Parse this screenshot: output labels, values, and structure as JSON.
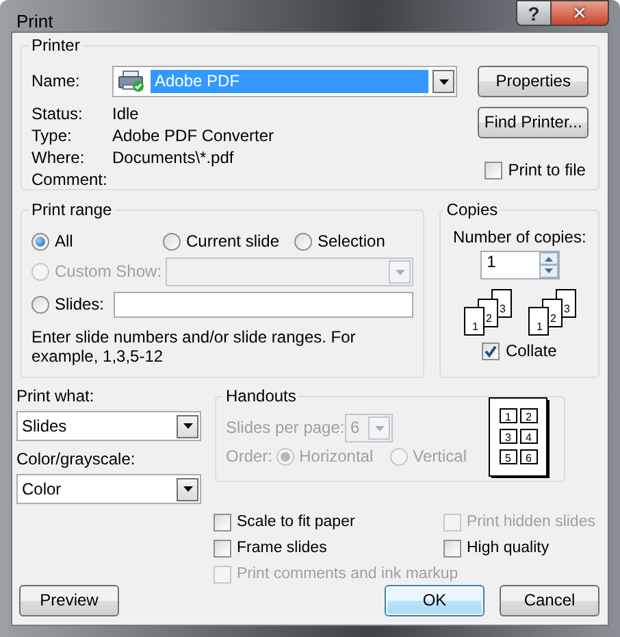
{
  "window": {
    "title": "Print",
    "help_button": "?",
    "close_button": "✕"
  },
  "printer": {
    "legend": "Printer",
    "name_label": "Name:",
    "name_value": "Adobe PDF",
    "name_highlighted": true,
    "info": [
      {
        "label": "Status:",
        "value": "Idle"
      },
      {
        "label": "Type:",
        "value": "Adobe PDF Converter"
      },
      {
        "label": "Where:",
        "value": "Documents\\*.pdf"
      },
      {
        "label": "Comment:"
      }
    ],
    "buttons": [
      "Properties",
      "Find Printer..."
    ],
    "print_to_file": {
      "label": "Print to file",
      "checked": false
    }
  },
  "print_range": {
    "legend": "Print range",
    "options": [
      {
        "label": "All",
        "selected": true,
        "disabled": false
      },
      {
        "label": "Current slide",
        "selected": false,
        "disabled": false
      },
      {
        "label": "Selection",
        "selected": false,
        "disabled": false
      },
      {
        "label": "Custom Show:",
        "selected": false,
        "disabled": true
      },
      {
        "label": "Slides:",
        "selected": false,
        "disabled": false
      }
    ],
    "custom_show_disabled": true,
    "hint": "Enter slide numbers and/or slide ranges. For example, 1,3,5-12"
  },
  "copies": {
    "legend": "Copies",
    "label": "Number of copies:",
    "value": "1",
    "stacks": [
      [
        "1",
        "2",
        "3"
      ],
      [
        "1",
        "2",
        "3"
      ]
    ],
    "collate": {
      "label": "Collate",
      "checked": true
    }
  },
  "print_what": {
    "label": "Print what:",
    "value": "Slides"
  },
  "color": {
    "label": "Color/grayscale:",
    "value": "Color"
  },
  "handouts": {
    "legend": "Handouts",
    "disabled": true,
    "per_page_label": "Slides per page:",
    "per_page_value": "6",
    "order_label": "Order:",
    "order_options": [
      {
        "label": "Horizontal",
        "selected": true
      },
      {
        "label": "Vertical",
        "selected": false
      }
    ],
    "preview": [
      "1",
      "2",
      "3",
      "4",
      "5",
      "6"
    ]
  },
  "checkboxes": [
    {
      "label": "Scale to fit paper",
      "checked": false,
      "disabled": false
    },
    {
      "label": "Print hidden slides",
      "checked": false,
      "disabled": true
    },
    {
      "label": "Frame slides",
      "checked": false,
      "disabled": false
    },
    {
      "label": "High quality",
      "checked": false,
      "disabled": false
    },
    {
      "label": "Print comments and ink markup",
      "checked": false,
      "disabled": true
    }
  ],
  "buttons": [
    {
      "label": "Preview",
      "default": false
    },
    {
      "label": "OK",
      "default": true
    },
    {
      "label": "Cancel",
      "default": false
    }
  ]
}
